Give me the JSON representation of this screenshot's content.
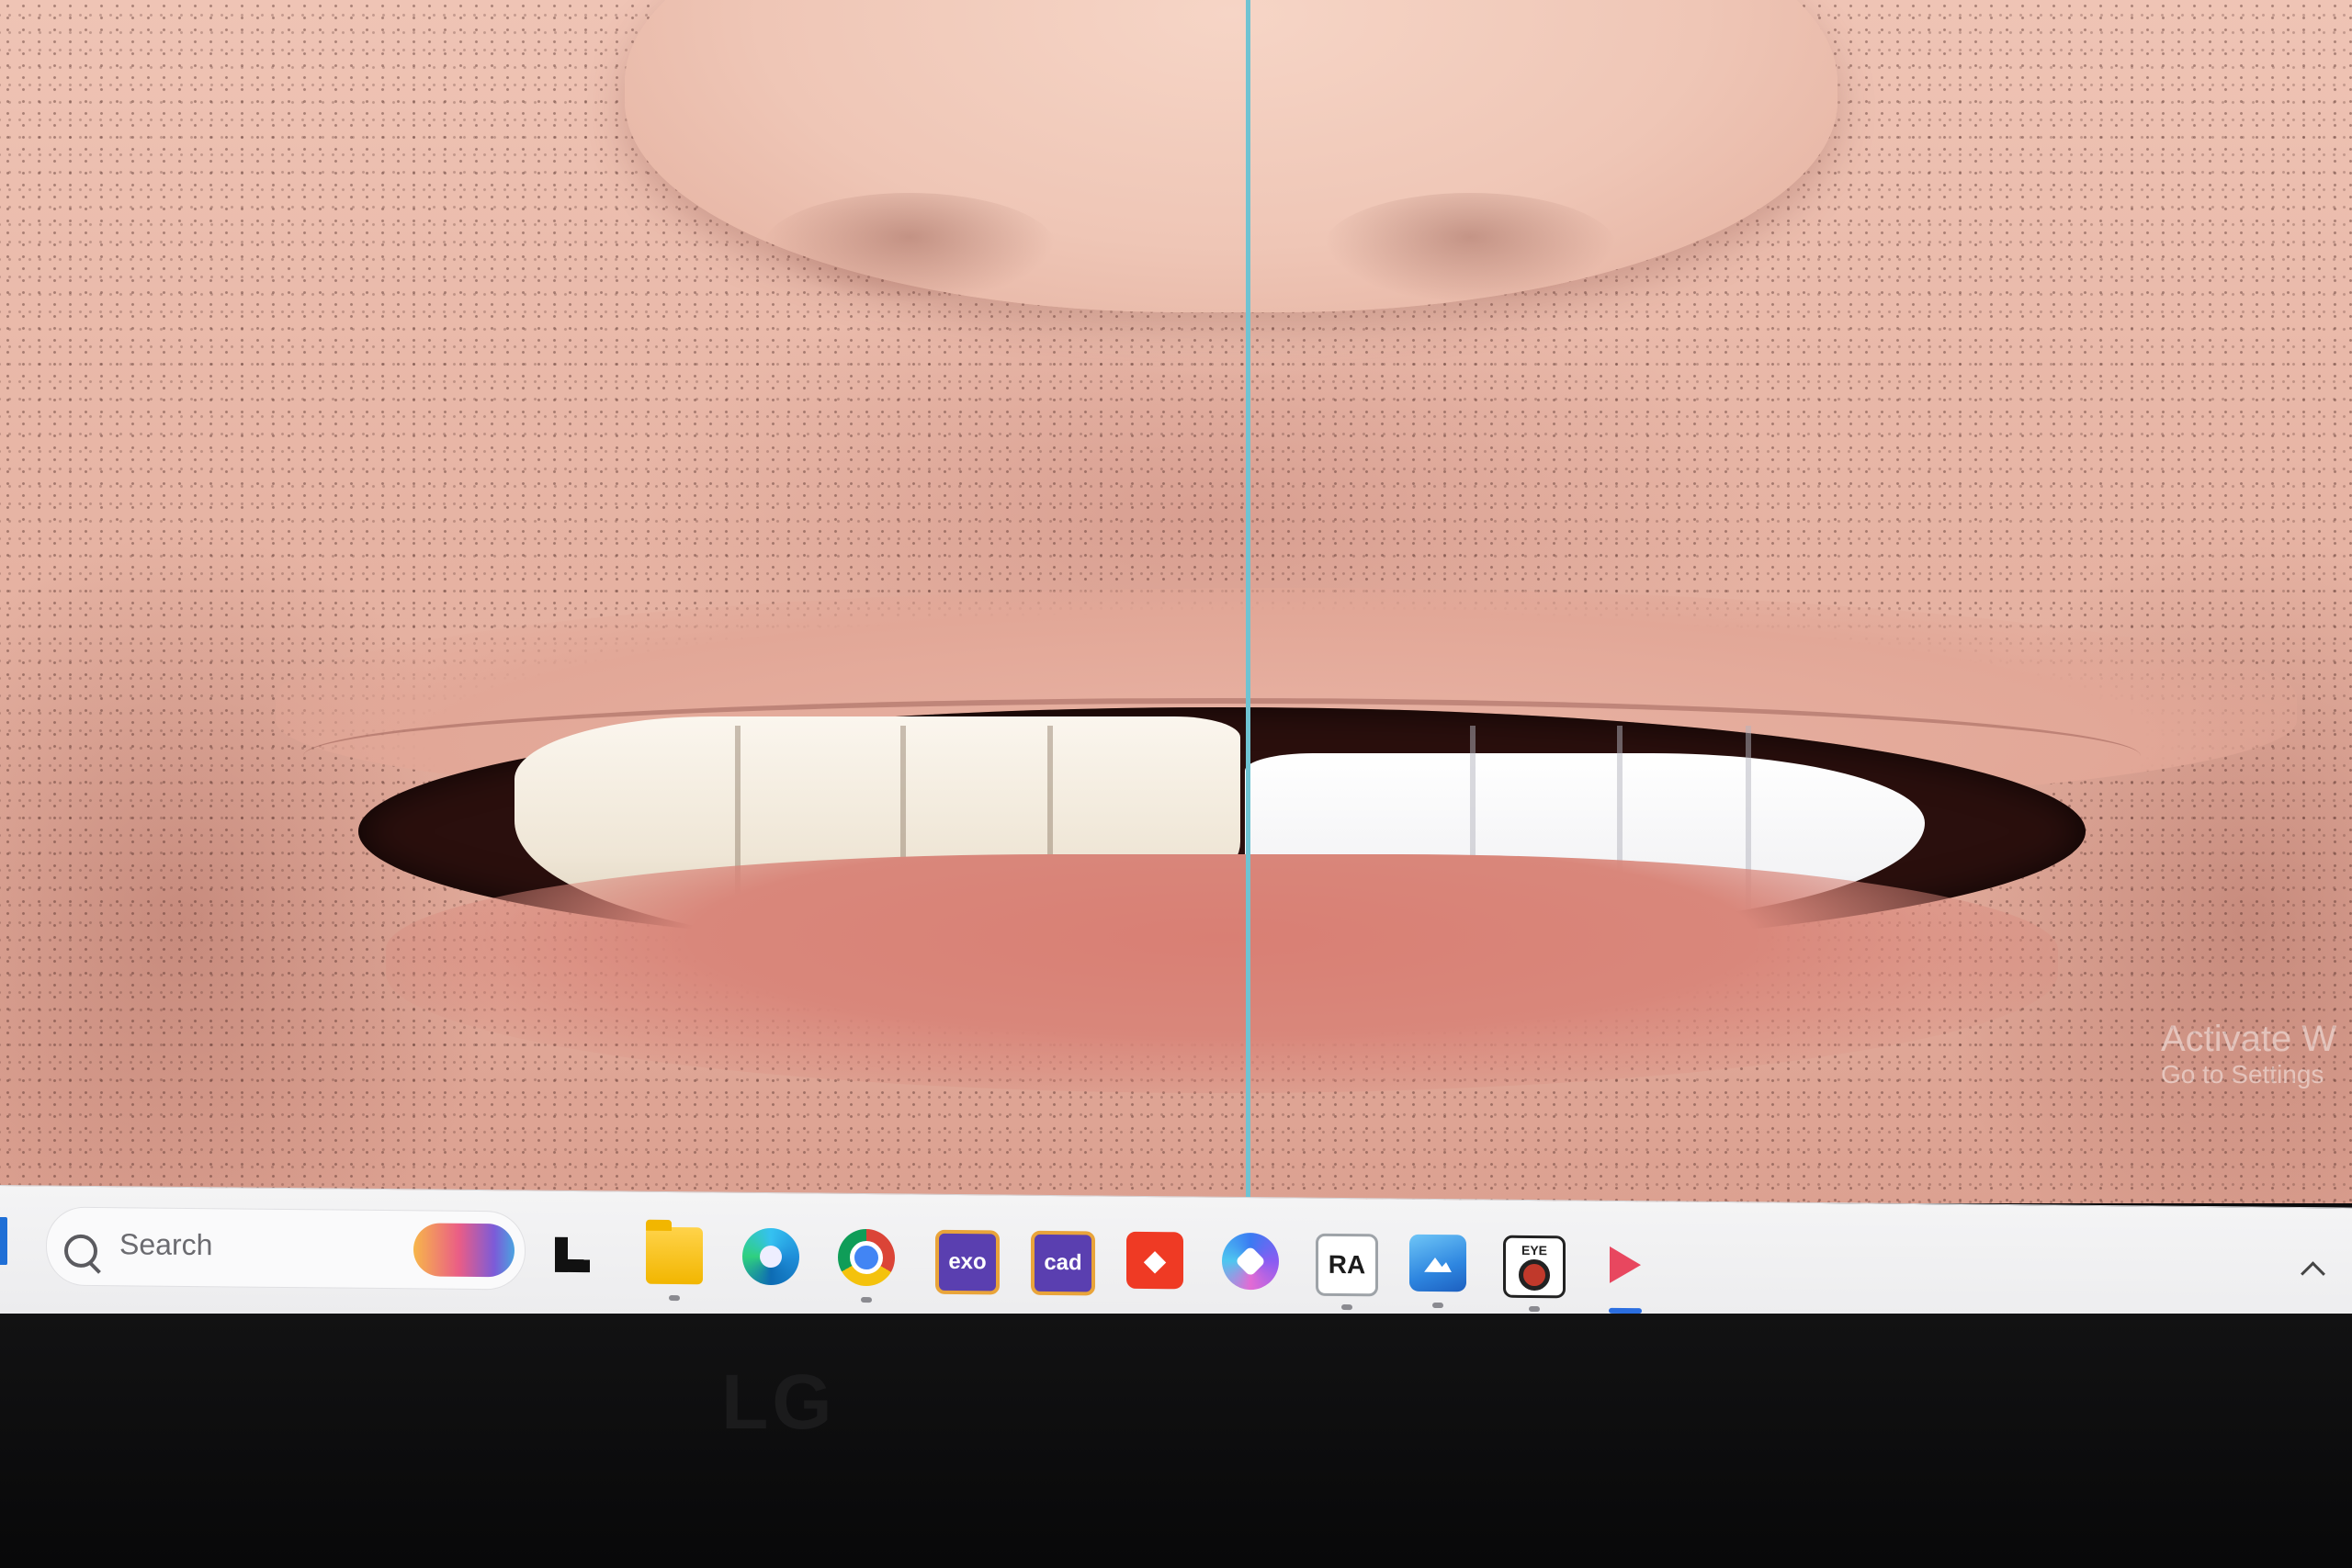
{
  "photo": {
    "divider_color": "#6fc3d2",
    "watermark": {
      "line1": "Activate W",
      "line2": "Go to Settings"
    }
  },
  "taskbar": {
    "search": {
      "label": "Search"
    },
    "apps": [
      {
        "name": "Task View",
        "icon": "task-view-icon"
      },
      {
        "name": "File Explorer",
        "icon": "folder-icon"
      },
      {
        "name": "Microsoft Edge",
        "icon": "edge-icon"
      },
      {
        "name": "Google Chrome",
        "icon": "chrome-icon"
      },
      {
        "name": "exocad",
        "icon": "exocad-icon",
        "label": "exo"
      },
      {
        "name": "cad",
        "icon": "cad-icon",
        "label": "cad"
      },
      {
        "name": "AnyDesk",
        "icon": "anydesk-icon"
      },
      {
        "name": "Copilot",
        "icon": "copilot-icon"
      },
      {
        "name": "RA",
        "icon": "ra-icon",
        "label": "RA"
      },
      {
        "name": "Photos",
        "icon": "photos-icon"
      },
      {
        "name": "Eye app",
        "icon": "eye-app-icon",
        "label": "EYE"
      },
      {
        "name": "Arrow app",
        "icon": "arrow-app-icon"
      }
    ],
    "accent_color": "#2b6ee0"
  },
  "monitor": {
    "brand": "LG"
  }
}
